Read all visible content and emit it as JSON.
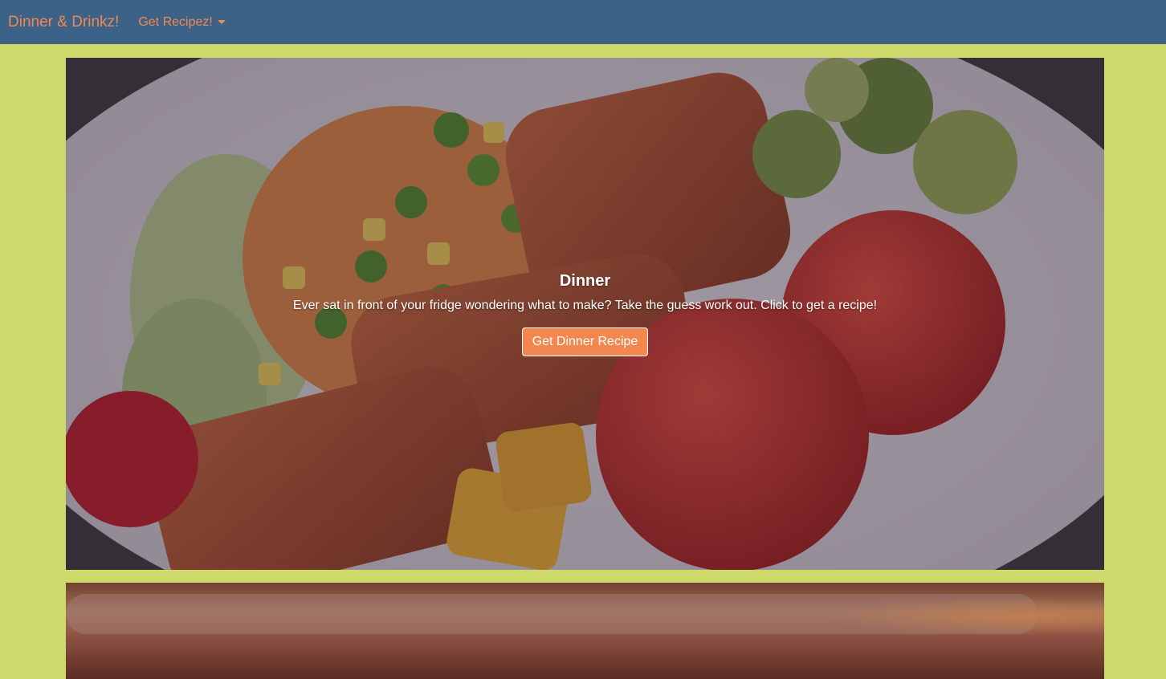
{
  "navbar": {
    "brand": "Dinner & Drinkz!",
    "dropdown_label": "Get Recipez!"
  },
  "dinner_card": {
    "title": "Dinner",
    "text": "Ever sat in front of your fridge wondering what to make? Take the guess work out. Click to get a recipe!",
    "button_label": "Get Dinner Recipe"
  },
  "colors": {
    "page_background": "#cdd96a",
    "navbar_background": "#3d6288",
    "accent": "#f08a55",
    "button_background": "#f2874f"
  }
}
